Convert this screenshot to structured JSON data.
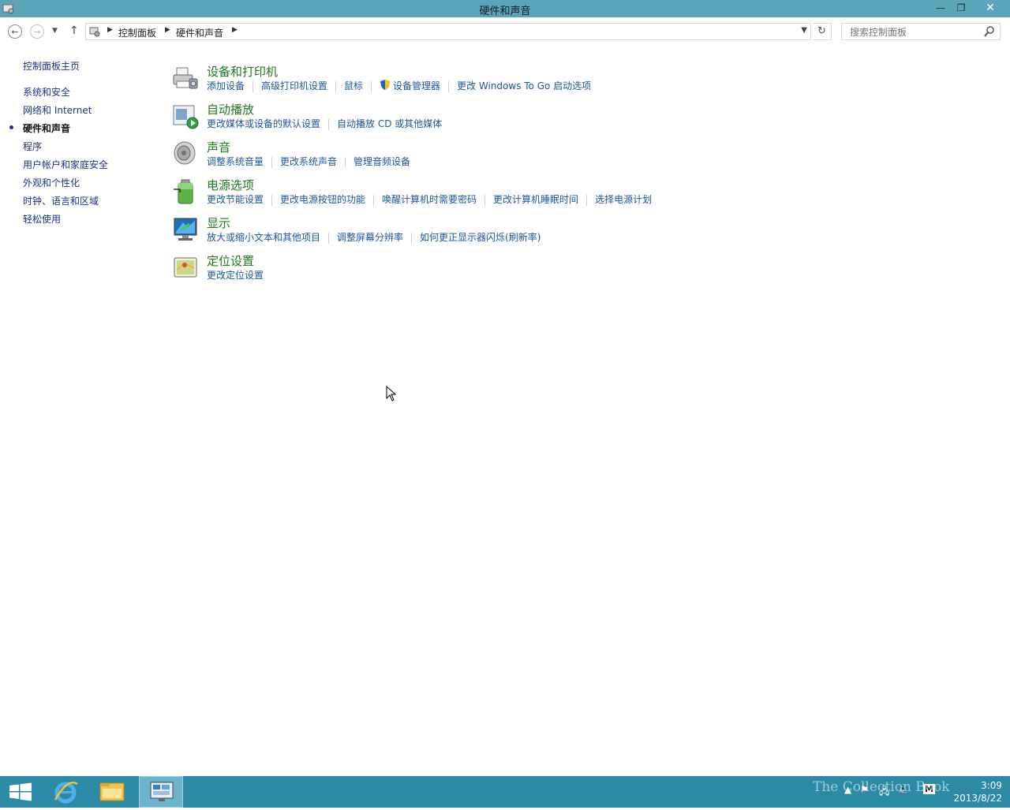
{
  "window": {
    "title": "硬件和声音",
    "app_icon": "control-panel-icon",
    "minimize": "—",
    "maximize": "❐",
    "close": "✕"
  },
  "nav": {
    "back": "←",
    "forward": "→",
    "up": "↑",
    "breadcrumb": [
      "控制面板",
      "硬件和声音"
    ],
    "refresh": "↻",
    "search_placeholder": "搜索控制面板"
  },
  "sidebar": {
    "home": "控制面板主页",
    "items": [
      {
        "label": "系统和安全",
        "current": false
      },
      {
        "label": "网络和 Internet",
        "current": false
      },
      {
        "label": "硬件和声音",
        "current": true
      },
      {
        "label": "程序",
        "current": false
      },
      {
        "label": "用户帐户和家庭安全",
        "current": false
      },
      {
        "label": "外观和个性化",
        "current": false
      },
      {
        "label": "时钟、语言和区域",
        "current": false
      },
      {
        "label": "轻松使用",
        "current": false
      }
    ]
  },
  "categories": [
    {
      "title": "设备和打印机",
      "icon": "printer-icon",
      "links": [
        "添加设备",
        "高级打印机设置",
        "鼠标",
        "设备管理器",
        "更改 Windows To Go 启动选项"
      ]
    },
    {
      "title": "自动播放",
      "icon": "autoplay-icon",
      "links": [
        "更改媒体或设备的默认设置",
        "自动播放 CD 或其他媒体"
      ]
    },
    {
      "title": "声音",
      "icon": "speaker-icon",
      "links": [
        "调整系统音量",
        "更改系统声音",
        "管理音频设备"
      ]
    },
    {
      "title": "电源选项",
      "icon": "battery-icon",
      "links": [
        "更改节能设置",
        "更改电源按钮的功能",
        "唤醒计算机时需要密码",
        "更改计算机睡眠时间",
        "选择电源计划"
      ]
    },
    {
      "title": "显示",
      "icon": "monitor-icon",
      "links": [
        "放大或缩小文本和其他项目",
        "调整屏幕分辨率",
        "如何更正显示器闪烁(刷新率)"
      ]
    },
    {
      "title": "定位设置",
      "icon": "location-icon",
      "links": [
        "更改定位设置"
      ]
    }
  ],
  "taskbar": {
    "clock_time": "3:09",
    "clock_date": "2013/8/22",
    "watermark": "The Collection Book",
    "ime": "M"
  },
  "colors": {
    "titlebar": "#5aa5b9",
    "taskbar": "#2c8aa6",
    "link": "#1e55a0",
    "category_title": "#1e7a1e"
  }
}
